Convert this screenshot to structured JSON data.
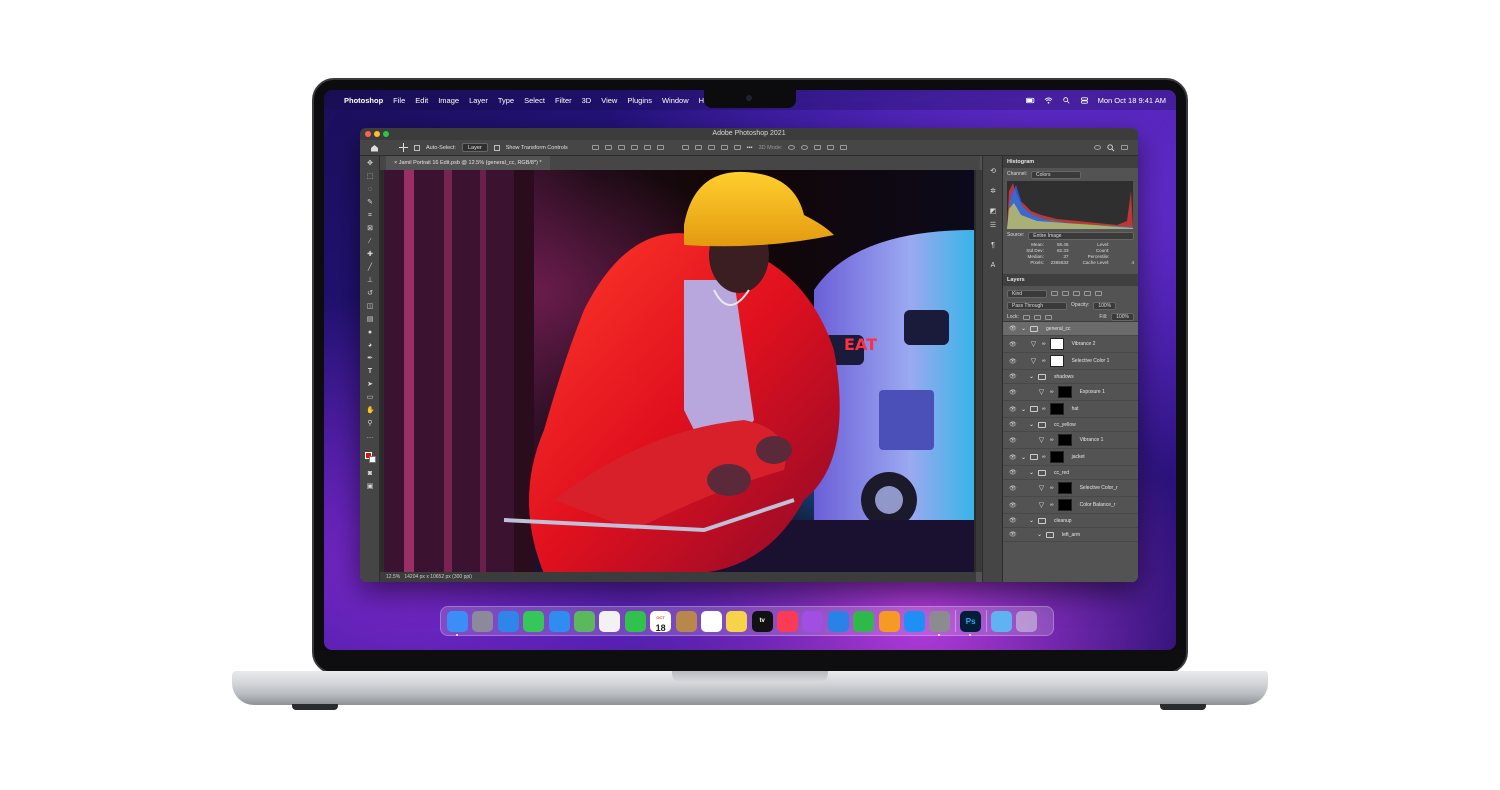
{
  "menubar": {
    "apple": "",
    "app": "Photoshop",
    "items": [
      "File",
      "Edit",
      "Image",
      "Layer",
      "Type",
      "Select",
      "Filter",
      "3D",
      "View",
      "Plugins",
      "Window",
      "Help"
    ],
    "datetime": "Mon Oct 18  9:41 AM"
  },
  "window": {
    "title": "Adobe Photoshop 2021",
    "options": {
      "auto_select_label": "Auto-Select:",
      "auto_select_value": "Layer",
      "transform_label": "Show Transform Controls",
      "mode_3d": "3D Mode:"
    },
    "doc_tab": "Jamil Portrait 16 Edit.psb @ 12.5% (general_cc, RGB/8*) *",
    "status_zoom": "12.5%",
    "status_info": "14204 px x 10652 px (300 ppi)"
  },
  "histogram": {
    "tab": "Histogram",
    "channel_label": "Channel:",
    "channel_value": "Colors",
    "source_label": "Source:",
    "source_value": "Entire Image",
    "stats_left": [
      {
        "label": "Mean:",
        "value": "58.46"
      },
      {
        "label": "Std Dev:",
        "value": "62.33"
      },
      {
        "label": "Median:",
        "value": "37"
      },
      {
        "label": "Pixels:",
        "value": "2365632"
      }
    ],
    "stats_right": [
      {
        "label": "Level:",
        "value": ""
      },
      {
        "label": "Count:",
        "value": ""
      },
      {
        "label": "Percentile:",
        "value": ""
      },
      {
        "label": "Cache Level:",
        "value": "4"
      }
    ]
  },
  "layers": {
    "tab": "Layers",
    "filter": "Kind",
    "blend": "Pass Through",
    "opacity_label": "Opacity:",
    "opacity": "100%",
    "lock_label": "Lock:",
    "fill_label": "Fill:",
    "fill": "100%",
    "items": [
      {
        "name": "general_cc",
        "kind": "group",
        "indent": 0,
        "selected": true
      },
      {
        "name": "Vibrance 2",
        "kind": "adjust",
        "indent": 1,
        "thumb": "#ffffff"
      },
      {
        "name": "Selective Color 1",
        "kind": "adjust",
        "indent": 1,
        "thumb": "#ffffff"
      },
      {
        "name": "shadows",
        "kind": "group",
        "indent": 1
      },
      {
        "name": "Exposure 1",
        "kind": "adjust",
        "indent": 2,
        "thumb": "#000000"
      },
      {
        "name": "hat",
        "kind": "group",
        "indent": 0,
        "thumb": "#000000"
      },
      {
        "name": "cc_yellow",
        "kind": "group",
        "indent": 1
      },
      {
        "name": "Vibrance 1",
        "kind": "adjust",
        "indent": 2,
        "thumb": "#000000"
      },
      {
        "name": "jacket",
        "kind": "group",
        "indent": 0,
        "thumb": "#000000"
      },
      {
        "name": "cc_red",
        "kind": "group",
        "indent": 1
      },
      {
        "name": "Selective Color_r",
        "kind": "adjust",
        "indent": 2,
        "thumb": "#000000"
      },
      {
        "name": "Color Balance_r",
        "kind": "adjust",
        "indent": 2,
        "thumb": "#000000"
      },
      {
        "name": "cleanup",
        "kind": "group",
        "indent": 1
      },
      {
        "name": "left_arm",
        "kind": "group",
        "indent": 2
      }
    ]
  },
  "dock": {
    "calendar_month": "OCT",
    "calendar_day": "18",
    "tv_label": "tv",
    "ps_label": "Ps",
    "apps": [
      {
        "name": "finder-icon",
        "color": "#3a8ef6"
      },
      {
        "name": "launchpad-icon",
        "color": "#8a8a9a"
      },
      {
        "name": "safari-icon",
        "color": "#2f86e8"
      },
      {
        "name": "messages-icon",
        "color": "#35c759"
      },
      {
        "name": "mail-icon",
        "color": "#2f8cf0"
      },
      {
        "name": "maps-icon",
        "color": "#5cb85c"
      },
      {
        "name": "photos-icon",
        "color": "#f2f2f2"
      },
      {
        "name": "facetime-icon",
        "color": "#31c14d"
      },
      {
        "name": "calendar-icon",
        "color": "#ffffff"
      },
      {
        "name": "contacts-icon",
        "color": "#b8874a"
      },
      {
        "name": "reminders-icon",
        "color": "#ffffff"
      },
      {
        "name": "notes-icon",
        "color": "#f7d34a"
      },
      {
        "name": "tv-icon",
        "color": "#111111"
      },
      {
        "name": "music-icon",
        "color": "#fb3b55"
      },
      {
        "name": "podcasts-icon",
        "color": "#a04fe0"
      },
      {
        "name": "keynote-icon",
        "color": "#2a82e6"
      },
      {
        "name": "numbers-icon",
        "color": "#2fb94a"
      },
      {
        "name": "pages-icon",
        "color": "#f59a23"
      },
      {
        "name": "app-store-icon",
        "color": "#1e90f5"
      },
      {
        "name": "system-preferences-icon",
        "color": "#8c8c90"
      }
    ]
  }
}
